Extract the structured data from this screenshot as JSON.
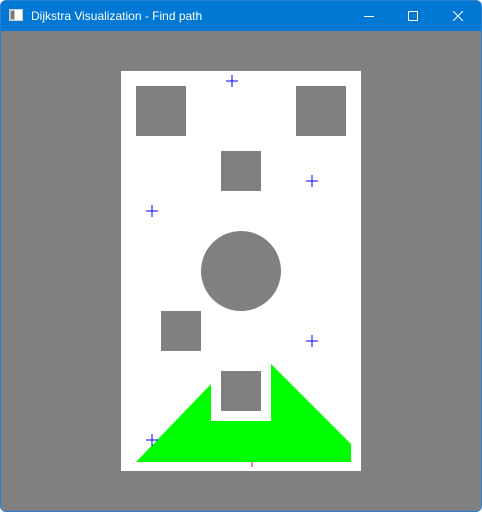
{
  "window": {
    "title": "Dijkstra Visualization - Find path"
  },
  "icons": {
    "app": "app-window-icon",
    "minimize": "minimize-icon",
    "maximize": "maximize-icon",
    "close": "close-icon"
  },
  "colors": {
    "titlebar": "#0078d4",
    "background": "#808080",
    "canvas": "#ffffff",
    "obstacle": "#808080",
    "path_area": "#00ff00",
    "waypoint_marker": "#0000ff",
    "end_marker": "#ff0000"
  },
  "scene": {
    "obstacles": [
      {
        "shape": "square"
      },
      {
        "shape": "square"
      },
      {
        "shape": "square"
      },
      {
        "shape": "circle"
      },
      {
        "shape": "square"
      },
      {
        "shape": "square"
      }
    ],
    "waypoint_count": 6,
    "path_region": "green polygon"
  }
}
